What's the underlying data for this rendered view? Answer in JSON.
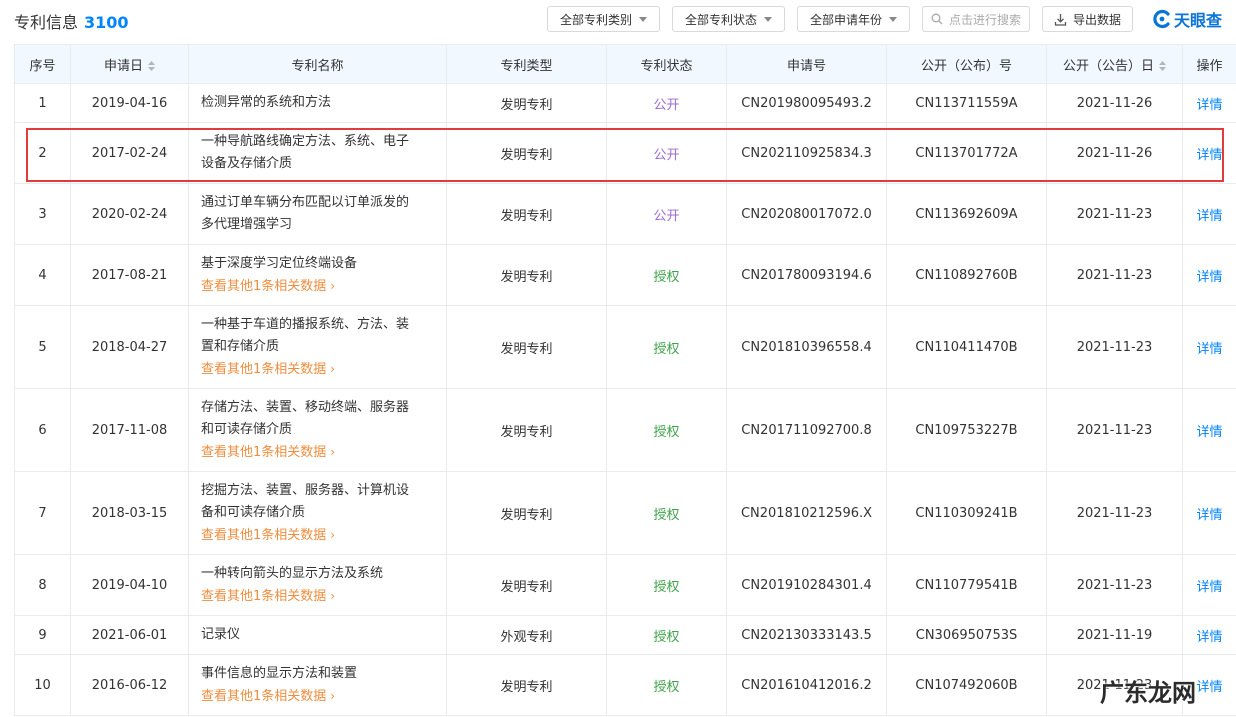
{
  "header": {
    "title": "专利信息",
    "count": "3100",
    "filters": [
      "全部专利类别",
      "全部专利状态",
      "全部申请年份"
    ],
    "search_placeholder": "点击进行搜索",
    "export_label": "导出数据",
    "brand": "天眼查"
  },
  "table": {
    "columns": [
      "序号",
      "申请日",
      "专利名称",
      "专利类型",
      "专利状态",
      "申请号",
      "公开（公布）号",
      "公开（公告）日",
      "操作"
    ],
    "more_label": "查看其他1条相关数据",
    "rows": [
      {
        "no": "1",
        "date": "2019-04-16",
        "name_lines": [
          "检测异常的系统和方法"
        ],
        "type": "发明专利",
        "status": "公开",
        "status_kind": "pub",
        "app_no": "CN201980095493.2",
        "pub_no": "CN113711559A",
        "pub_date": "2021-11-26",
        "action": "详情",
        "has_more": false
      },
      {
        "no": "2",
        "date": "2017-02-24",
        "name_lines": [
          "一种导航路线确定方法、系统、电子",
          "设备及存储介质"
        ],
        "type": "发明专利",
        "status": "公开",
        "status_kind": "pub",
        "app_no": "CN202110925834.3",
        "pub_no": "CN113701772A",
        "pub_date": "2021-11-26",
        "action": "详情",
        "has_more": false
      },
      {
        "no": "3",
        "date": "2020-02-24",
        "name_lines": [
          "通过订单车辆分布匹配以订单派发的",
          "多代理增强学习"
        ],
        "type": "发明专利",
        "status": "公开",
        "status_kind": "pub",
        "app_no": "CN202080017072.0",
        "pub_no": "CN113692609A",
        "pub_date": "2021-11-23",
        "action": "详情",
        "has_more": false
      },
      {
        "no": "4",
        "date": "2017-08-21",
        "name_lines": [
          "基于深度学习定位终端设备"
        ],
        "type": "发明专利",
        "status": "授权",
        "status_kind": "grant",
        "app_no": "CN201780093194.6",
        "pub_no": "CN110892760B",
        "pub_date": "2021-11-23",
        "action": "详情",
        "has_more": true
      },
      {
        "no": "5",
        "date": "2018-04-27",
        "name_lines": [
          "一种基于车道的播报系统、方法、装",
          "置和存储介质"
        ],
        "type": "发明专利",
        "status": "授权",
        "status_kind": "grant",
        "app_no": "CN201810396558.4",
        "pub_no": "CN110411470B",
        "pub_date": "2021-11-23",
        "action": "详情",
        "has_more": true
      },
      {
        "no": "6",
        "date": "2017-11-08",
        "name_lines": [
          "存储方法、装置、移动终端、服务器",
          "和可读存储介质"
        ],
        "type": "发明专利",
        "status": "授权",
        "status_kind": "grant",
        "app_no": "CN201711092700.8",
        "pub_no": "CN109753227B",
        "pub_date": "2021-11-23",
        "action": "详情",
        "has_more": true
      },
      {
        "no": "7",
        "date": "2018-03-15",
        "name_lines": [
          "挖掘方法、装置、服务器、计算机设",
          "备和可读存储介质"
        ],
        "type": "发明专利",
        "status": "授权",
        "status_kind": "grant",
        "app_no": "CN201810212596.X",
        "pub_no": "CN110309241B",
        "pub_date": "2021-11-23",
        "action": "详情",
        "has_more": true
      },
      {
        "no": "8",
        "date": "2019-04-10",
        "name_lines": [
          "一种转向箭头的显示方法及系统"
        ],
        "type": "发明专利",
        "status": "授权",
        "status_kind": "grant",
        "app_no": "CN201910284301.4",
        "pub_no": "CN110779541B",
        "pub_date": "2021-11-23",
        "action": "详情",
        "has_more": true
      },
      {
        "no": "9",
        "date": "2021-06-01",
        "name_lines": [
          "记录仪"
        ],
        "type": "外观专利",
        "status": "授权",
        "status_kind": "grant",
        "app_no": "CN202130333143.5",
        "pub_no": "CN306950753S",
        "pub_date": "2021-11-19",
        "action": "详情",
        "has_more": false
      },
      {
        "no": "10",
        "date": "2016-06-12",
        "name_lines": [
          "事件信息的显示方法和装置"
        ],
        "type": "发明专利",
        "status": "授权",
        "status_kind": "grant",
        "app_no": "CN201610412016.2",
        "pub_no": "CN107492060B",
        "pub_date": "2021-11-23",
        "action": "详情",
        "has_more": true
      }
    ]
  },
  "watermark": "广东龙网",
  "colors": {
    "accent": "#0084ff",
    "status_pub": "#9b6bd3",
    "status_grant": "#3fa44a",
    "more_link": "#f08d3e",
    "highlight_border": "#e23b3b",
    "header_bg": "#f2f8ff"
  },
  "icons": {
    "search": "search-icon",
    "export": "download-icon",
    "brand": "tianyancha-logo-icon",
    "sort": "sort-icon",
    "dropdown": "caret-down-icon"
  }
}
